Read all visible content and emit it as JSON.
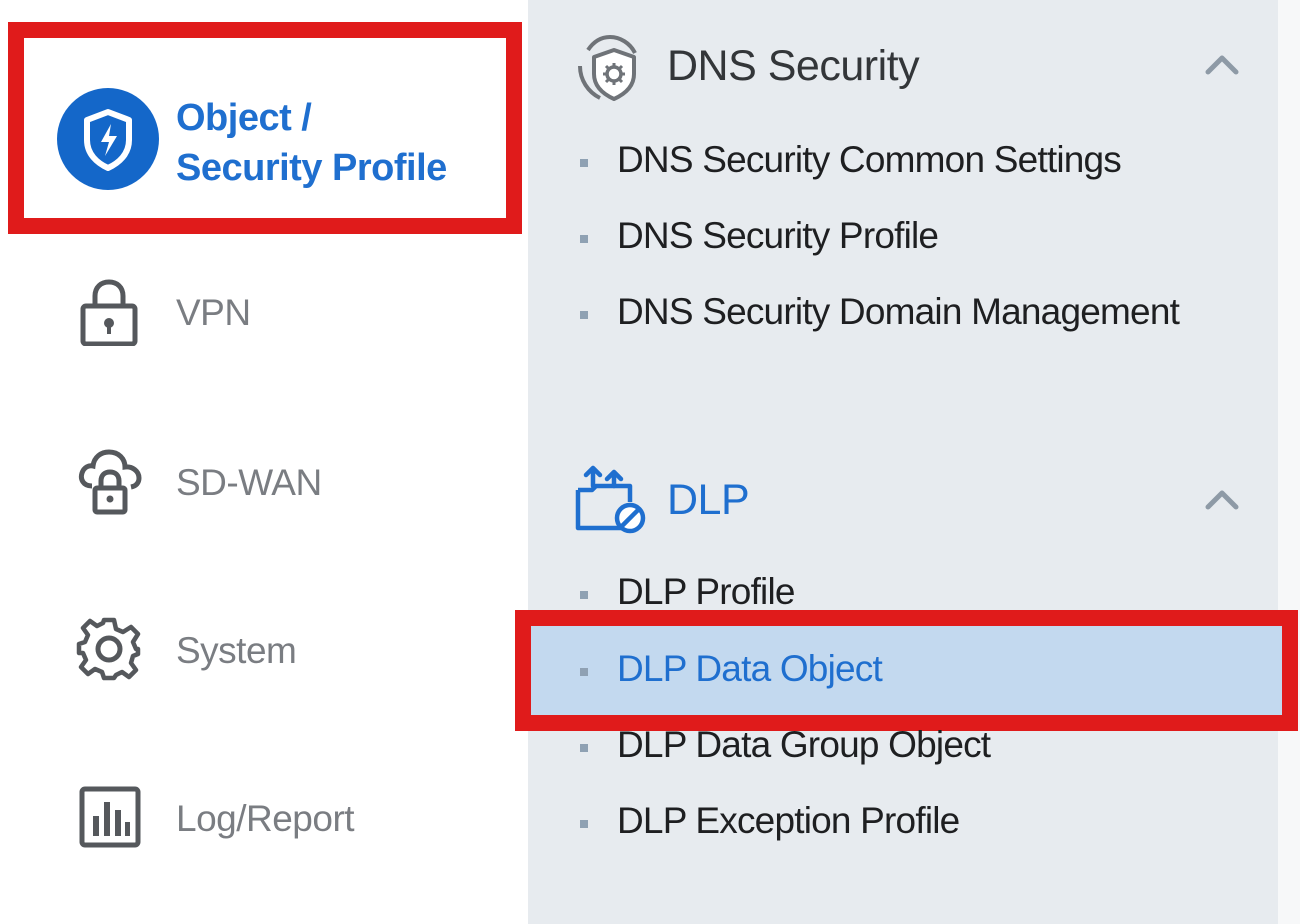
{
  "left_nav": {
    "active_item": {
      "label_line1": "Object /",
      "label_line2": "Security Profile",
      "icon": "shield-icon"
    },
    "items": [
      {
        "label": "VPN",
        "icon": "lock-icon"
      },
      {
        "label": "SD-WAN",
        "icon": "cloud-lock-icon"
      },
      {
        "label": "System",
        "icon": "gear-icon"
      },
      {
        "label": "Log/Report",
        "icon": "bar-chart-icon"
      }
    ]
  },
  "submenu": {
    "sections": [
      {
        "title": "DNS Security",
        "icon": "dns-security-icon",
        "expanded": true,
        "items": [
          "DNS Security Common Settings",
          "DNS Security Profile",
          "DNS Security Domain Management"
        ]
      },
      {
        "title": "DLP",
        "icon": "dlp-folder-icon",
        "expanded": true,
        "items": [
          "DLP Profile",
          "DLP Data Object",
          "DLP Data Group Object",
          "DLP Exception Profile"
        ],
        "selected_item": "DLP Data Object"
      }
    ]
  },
  "colors": {
    "accent": "#1f6fcf",
    "highlight": "#e01b1b",
    "selected_bg": "#c3d9ef",
    "panel_bg": "#e7ebef"
  }
}
